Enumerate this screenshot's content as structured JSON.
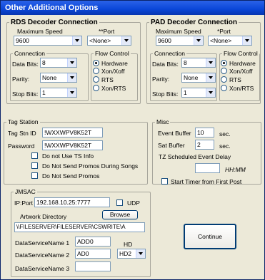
{
  "window": {
    "title": "Other Additional Options"
  },
  "rds": {
    "title": "RDS Decoder Connection",
    "max_speed_label": "Maximum Speed",
    "max_speed_value": "9600",
    "port_label": "**Port",
    "port_value": "<None>",
    "connection_label": "Connection",
    "data_bits_label": "Data Bits:",
    "data_bits_value": "8",
    "parity_label": "Parity:",
    "parity_value": "None",
    "stop_bits_label": "Stop Bits:",
    "stop_bits_value": "1",
    "flow_label": "Flow Control",
    "flow_options": [
      "Hardware",
      "Xon/Xoff",
      "RTS",
      "Xon/RTS"
    ],
    "flow_selected": "Hardware"
  },
  "pad": {
    "title": "PAD Decoder Connection",
    "max_speed_label": "Maximum Speed",
    "max_speed_value": "9600",
    "port_label": "*Port",
    "port_value": "<None>",
    "connection_label": "Connection",
    "data_bits_label": "Data Bits:",
    "data_bits_value": "8",
    "parity_label": "Parity:",
    "parity_value": "None",
    "stop_bits_label": "Stop Bits:",
    "stop_bits_value": "1",
    "flow_label": "Flow Control",
    "flow_options": [
      "Hardware",
      "Xon/Xoff",
      "RTS",
      "Xon/RTS"
    ],
    "flow_selected": "Hardware"
  },
  "tag": {
    "title": "Tag Station",
    "stn_id_label": "Tag Stn ID",
    "stn_id_value": "!WXXWPV8K52T",
    "password_label": "Password",
    "password_value": "!WXXWPV8K52T",
    "no_ts_info_label": "Do not Use TS Info",
    "no_promos_songs_label": "Do Not Send Promos During Songs",
    "no_promos_label": "Do Not Send Promos"
  },
  "misc": {
    "title": "Misc",
    "event_buffer_label": "Event Buffer",
    "event_buffer_value": "10",
    "event_buffer_unit": "sec.",
    "sat_buffer_label": "Sat Buffer",
    "sat_buffer_value": "2",
    "sat_buffer_unit": "sec.",
    "tz_label": "TZ Scheduled Event Delay",
    "tz_value": "",
    "tz_format": "HH:MM",
    "start_timer_label": "Start Timer from First Post"
  },
  "jmsac": {
    "title": "JMSAC",
    "ip_label": "IP:Port",
    "ip_value": "192.168.10.25:7777",
    "udp_label": "UDP",
    "artwork_label": "Artwork Directory",
    "browse_label": "Browse",
    "artwork_value": "\\\\FILESERVER\\FILESERVER\\CSWRITE\\A",
    "ds1_label": "DataServiceName 1",
    "ds1_value": "ADD0",
    "ds1_suffix": "HD",
    "ds2_label": "DataServiceName 2",
    "ds2_value": "AD0",
    "ds2_select": "HD2",
    "ds3_label": "DataServiceName 3",
    "ds3_value": ""
  },
  "continue_label": "Continue"
}
